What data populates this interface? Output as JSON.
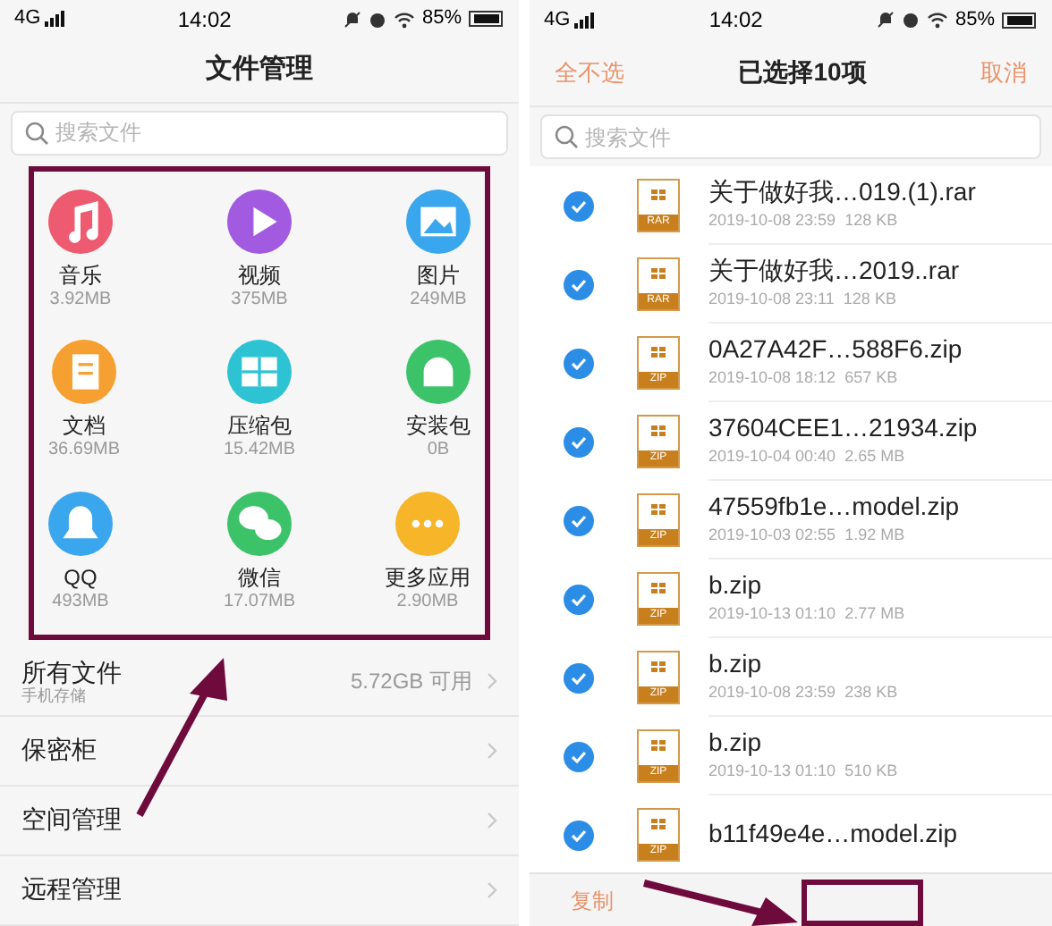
{
  "left": {
    "status": {
      "network": "4G",
      "time": "14:02",
      "battery": "85%"
    },
    "title": "文件管理",
    "search": {
      "placeholder": "搜索文件"
    },
    "categories": [
      {
        "kind": "music",
        "name": "音乐",
        "size": "3.92MB",
        "color": "#ee5a6f"
      },
      {
        "kind": "video",
        "name": "视频",
        "size": "375MB",
        "color": "#a25be0"
      },
      {
        "kind": "image",
        "name": "图片",
        "size": "249MB",
        "color": "#3aa6ee"
      },
      {
        "kind": "doc",
        "name": "文档",
        "size": "36.69MB",
        "color": "#f5a030"
      },
      {
        "kind": "zip",
        "name": "压缩包",
        "size": "15.42MB",
        "color": "#2ec3d3"
      },
      {
        "kind": "apk",
        "name": "安装包",
        "size": "0B",
        "color": "#3cc36a"
      },
      {
        "kind": "qq",
        "name": "QQ",
        "size": "493MB",
        "color": "#3aa6ee"
      },
      {
        "kind": "wechat",
        "name": "微信",
        "size": "17.07MB",
        "color": "#3cc36a"
      },
      {
        "kind": "more",
        "name": "更多应用",
        "size": "2.90MB",
        "color": "#f7b52a"
      }
    ],
    "menu": [
      {
        "label": "所有文件",
        "sublabel": "手机存储",
        "value": "5.72GB 可用"
      },
      {
        "label": "保密柜"
      },
      {
        "label": "空间管理"
      },
      {
        "label": "远程管理"
      }
    ]
  },
  "right": {
    "status": {
      "network": "4G",
      "time": "14:02",
      "battery": "85%"
    },
    "deselect_all": "全不选",
    "title": "已选择10项",
    "cancel": "取消",
    "search": {
      "placeholder": "搜索文件"
    },
    "files": [
      {
        "type": "RAR",
        "name": "关于做好我…019.(1).rar",
        "date": "2019-10-08 23:59",
        "size": "128 KB",
        "checked": true
      },
      {
        "type": "RAR",
        "name": "关于做好我…2019..rar",
        "date": "2019-10-08 23:11",
        "size": "128 KB",
        "checked": true
      },
      {
        "type": "ZIP",
        "name": "0A27A42F…588F6.zip",
        "date": "2019-10-08 18:12",
        "size": "657 KB",
        "checked": true
      },
      {
        "type": "ZIP",
        "name": "37604CEE1…21934.zip",
        "date": "2019-10-04 00:40",
        "size": "2.65 MB",
        "checked": true
      },
      {
        "type": "ZIP",
        "name": "47559fb1e…model.zip",
        "date": "2019-10-03 02:55",
        "size": "1.92 MB",
        "checked": true
      },
      {
        "type": "ZIP",
        "name": "b.zip",
        "date": "2019-10-13 01:10",
        "size": "2.77 MB",
        "checked": true
      },
      {
        "type": "ZIP",
        "name": "b.zip",
        "date": "2019-10-08 23:59",
        "size": "238 KB",
        "checked": true
      },
      {
        "type": "ZIP",
        "name": "b.zip",
        "date": "2019-10-13 01:10",
        "size": "510 KB",
        "checked": true
      },
      {
        "type": "ZIP",
        "name": "b11f49e4e…model.zip",
        "checked": true
      }
    ],
    "actions": [
      "复制"
    ]
  }
}
